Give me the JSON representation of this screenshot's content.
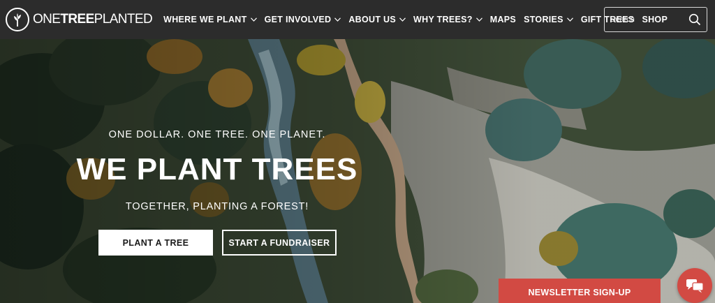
{
  "brand": {
    "name_part1": "ONE",
    "name_part2": "TREE",
    "name_part3": "PLANTED"
  },
  "nav": {
    "items": [
      {
        "label": "WHERE WE PLANT",
        "dropdown": true
      },
      {
        "label": "GET INVOLVED",
        "dropdown": true
      },
      {
        "label": "ABOUT US",
        "dropdown": true
      },
      {
        "label": "WHY TREES?",
        "dropdown": true
      },
      {
        "label": "MAPS",
        "dropdown": false
      },
      {
        "label": "STORIES",
        "dropdown": true
      },
      {
        "label": "GIFT TREES",
        "dropdown": false
      },
      {
        "label": "SHOP",
        "dropdown": false
      }
    ]
  },
  "search": {
    "placeholder": "Search",
    "icon": "search-icon"
  },
  "hero": {
    "tagline": "ONE DOLLAR. ONE TREE. ONE PLANET.",
    "headline": "WE PLANT TREES",
    "subline": "TOGETHER, PLANTING A FOREST!",
    "primary_button": "PLANT A TREE",
    "secondary_button": "START A FUNDRAISER"
  },
  "newsletter": {
    "label": "NEWSLETTER SIGN-UP"
  },
  "chat": {
    "icon": "chat-icon"
  },
  "colors": {
    "nav_bg": "#2c2c2c",
    "accent_red": "#d24a43",
    "text_white": "#ffffff"
  }
}
